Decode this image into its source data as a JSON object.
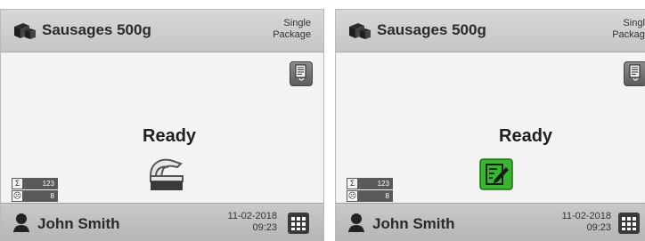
{
  "colors": {
    "header_bg": "#cbcbcb",
    "body_bg": "#f3f3f3",
    "footer_bg": "#bcbcbc",
    "counter_bg": "#5a5a5a",
    "edit_accent": "#35b82b"
  },
  "screens": [
    {
      "product_name": "Sausages 500g",
      "mode_label_line1": "Single",
      "mode_label_line2": "Package",
      "status": "Ready",
      "status_icon": "scale-icon",
      "counters": [
        {
          "icon": "sigma-icon",
          "glyph": "Σ",
          "value": "123"
        },
        {
          "icon": "sad-face-icon",
          "glyph": "☹",
          "value": "8"
        }
      ],
      "user_name": "John Smith",
      "date": "11-02-2018",
      "time": "09:23",
      "icons": [
        "product-icon",
        "report-icon",
        "user-icon",
        "menu-grid-icon"
      ]
    },
    {
      "product_name": "Sausages 500g",
      "mode_label_line1": "Single",
      "mode_label_line2": "Package",
      "status": "Ready",
      "status_icon": "edit-icon",
      "counters": [
        {
          "icon": "sigma-icon",
          "glyph": "Σ",
          "value": "123"
        },
        {
          "icon": "sad-face-icon",
          "glyph": "☹",
          "value": "8"
        }
      ],
      "user_name": "John Smith",
      "date": "11-02-2018",
      "time": "09:23",
      "icons": [
        "product-icon",
        "report-icon",
        "user-icon",
        "menu-grid-icon"
      ]
    }
  ]
}
